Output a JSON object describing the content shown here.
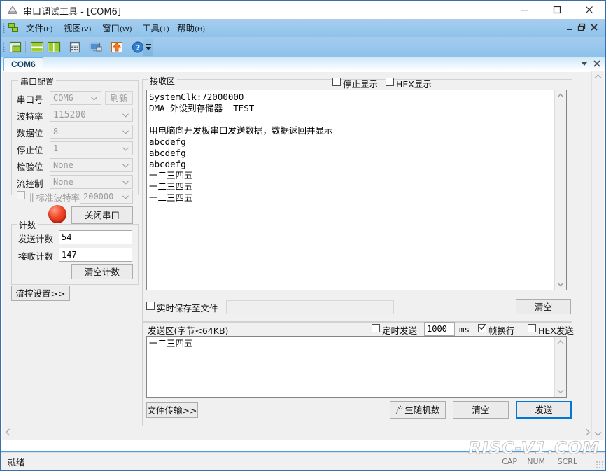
{
  "window": {
    "title": "串口调试工具 - [COM6]",
    "icon": "serial-tool-icon",
    "minimize": "minimize-icon",
    "maximize": "maximize-icon",
    "close": "close-icon"
  },
  "menu": {
    "items": [
      {
        "name": "文件",
        "key": "(F)"
      },
      {
        "name": "视图",
        "key": "(V)"
      },
      {
        "name": "窗口",
        "key": "(W)"
      },
      {
        "name": "工具",
        "key": "(T)"
      },
      {
        "name": "帮助",
        "key": "(H)"
      }
    ],
    "mdi_minimize": "mdi-minimize-icon",
    "mdi_restore": "mdi-restore-icon",
    "mdi_close": "mdi-close-icon"
  },
  "toolbar": {
    "buttons": [
      "new-window-icon",
      "tile-horizontal-icon",
      "tile-vertical-icon",
      "calculator-icon",
      "terminal-icon",
      "upload-icon",
      "help-icon"
    ],
    "overflow": "toolbar-overflow-icon"
  },
  "tabs": {
    "items": [
      "COM6"
    ],
    "active": "COM6",
    "list_button": "tab-list-icon",
    "close_button": "tab-close-icon"
  },
  "serial_config": {
    "caption": "串口配置",
    "port_label": "串口号",
    "port_value": "COM6",
    "refresh_button": "刷新",
    "baud_label": "波特率",
    "baud_value": "115200",
    "databits_label": "数据位",
    "databits_value": "8",
    "stopbits_label": "停止位",
    "stopbits_value": "1",
    "parity_label": "检验位",
    "parity_value": "None",
    "flow_label": "流控制",
    "flow_value": "None",
    "custom_baud_label": "非标准波特率",
    "custom_baud_value": "200000",
    "custom_baud_checked": false
  },
  "port_action": {
    "led": "port-status-led",
    "button": "关闭串口"
  },
  "counters": {
    "caption": "计数",
    "tx_label": "发送计数",
    "tx_value": "54",
    "rx_label": "接收计数",
    "rx_value": "147",
    "clear_button": "清空计数"
  },
  "flow_settings_button": "流控设置>>",
  "receive": {
    "caption": "接收区",
    "stop_display_label": "停止显示",
    "stop_display_checked": false,
    "hex_display_label": "HEX显示",
    "hex_display_checked": false,
    "text": "SystemClk:72000000\nDMA 外设到存储器  TEST\n\n用电脑向开发板串口发送数据，数据返回并显示\nabcdefg\nabcdefg\nabcdefg\n一二三四五\n一二三四五\n一二三四五",
    "save_to_file_label": "实时保存至文件",
    "save_to_file_checked": false,
    "save_path_value": "",
    "clear_button": "清空",
    "scroll_up": "scroll-up-icon",
    "scroll_down": "scroll-down-icon"
  },
  "send": {
    "caption": "发送区(字节<64KB)",
    "timed_send_label": "定时发送",
    "timed_send_checked": false,
    "interval_value": "1000",
    "interval_unit": "ms",
    "frame_newline_label": "帧换行",
    "frame_newline_checked": true,
    "hex_send_label": "HEX发送",
    "hex_send_checked": false,
    "text": "一二三四五",
    "file_transfer_button": "文件传输>>",
    "random_button": "产生随机数",
    "clear_button": "清空",
    "send_button": "发送"
  },
  "statusbar": {
    "text": "就绪",
    "caps": "CAP",
    "num": "NUM",
    "scrl": "SCRL"
  },
  "watermark": "RISC-V1.COM",
  "colors": {
    "menu_blue": "#9ccaee",
    "tab_border": "#6ab6e8",
    "focus_blue": "#0078d7",
    "led_red": "#f04a28"
  }
}
